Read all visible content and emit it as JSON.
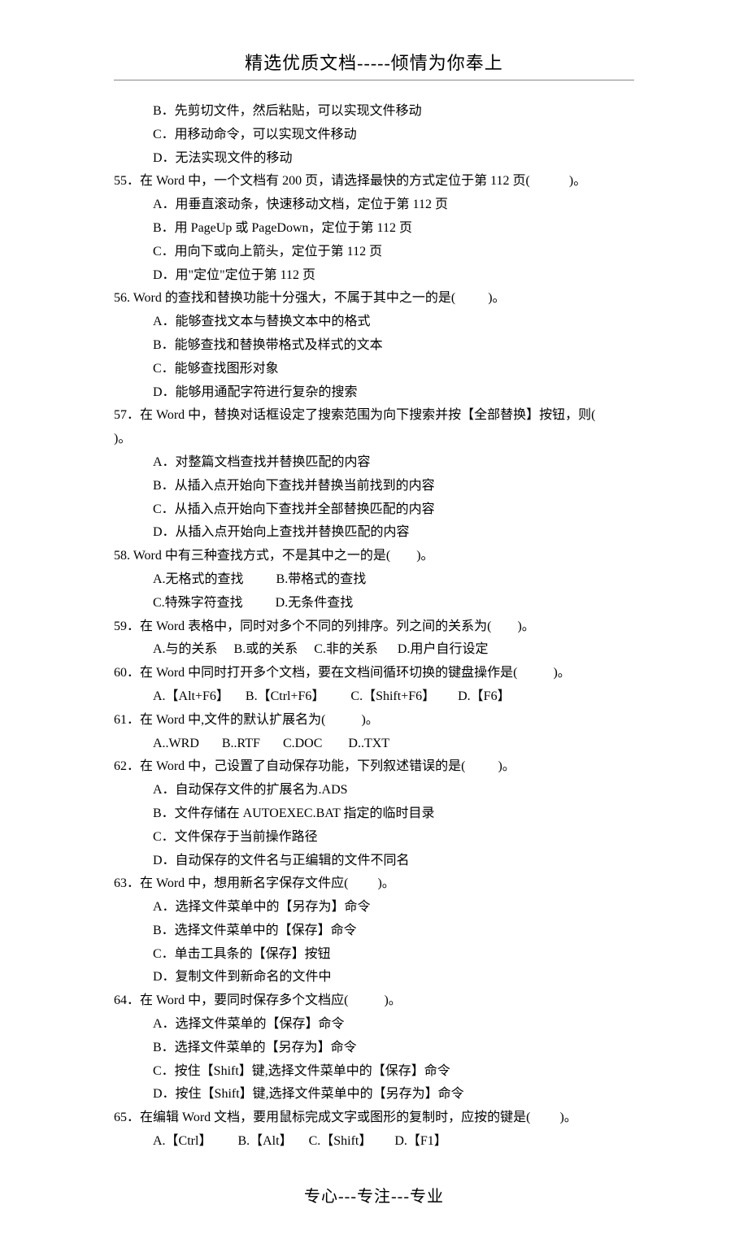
{
  "header": "精选优质文档-----倾情为你奉上",
  "footer": "专心---专注---专业",
  "lines": [
    {
      "cls": "indent-option",
      "text": "B．先剪切文件，然后粘贴，可以实现文件移动"
    },
    {
      "cls": "indent-option",
      "text": "C．用移动命令，可以实现文件移动"
    },
    {
      "cls": "indent-option",
      "text": "D．无法实现文件的移动"
    },
    {
      "cls": "indent-q",
      "text": "55．在 Word 中，一个文档有 200 页，请选择最快的方式定位于第 112 页(            )。"
    },
    {
      "cls": "indent-option",
      "text": "A．用垂直滚动条，快速移动文档，定位于第 112 页"
    },
    {
      "cls": "indent-option",
      "text": "B．用 PageUp 或 PageDown，定位于第 112 页"
    },
    {
      "cls": "indent-option",
      "text": "C．用向下或向上箭头，定位于第 112 页"
    },
    {
      "cls": "indent-option",
      "text": "D．用\"定位\"定位于第 112 页"
    },
    {
      "cls": "indent-q",
      "text": "56. Word 的查找和替换功能十分强大，不属于其中之一的是(          )。"
    },
    {
      "cls": "indent-option",
      "text": "A．能够查找文本与替换文本中的格式"
    },
    {
      "cls": "indent-option",
      "text": "B．能够查找和替换带格式及样式的文本"
    },
    {
      "cls": "indent-option",
      "text": "C．能够查找图形对象"
    },
    {
      "cls": "indent-option",
      "text": "D．能够用通配字符进行复杂的搜索"
    },
    {
      "cls": "indent-q",
      "text": "57．在 Word 中，替换对话框设定了搜索范围为向下搜索并按【全部替换】按钮，则(       )。"
    },
    {
      "cls": "indent-option",
      "text": "A．对整篇文档查找并替换匹配的内容"
    },
    {
      "cls": "indent-option",
      "text": "B．从插入点开始向下查找并替换当前找到的内容"
    },
    {
      "cls": "indent-option",
      "text": "C．从插入点开始向下查找并全部替换匹配的内容"
    },
    {
      "cls": "indent-option",
      "text": "D．从插入点开始向上查找并替换匹配的内容"
    },
    {
      "cls": "indent-q",
      "text": "58. Word 中有三种查找方式，不是其中之一的是(        )。"
    },
    {
      "cls": "indent-option",
      "text": "A.无格式的查找          B.带格式的查找"
    },
    {
      "cls": "indent-option",
      "text": "C.特殊字符查找          D.无条件查找"
    },
    {
      "cls": "indent-q",
      "text": "59．在 Word 表格中，同时对多个不同的列排序。列之间的关系为(        )。"
    },
    {
      "cls": "indent-option",
      "text": "A.与的关系     B.或的关系     C.非的关系      D.用户自行设定"
    },
    {
      "cls": "indent-q",
      "text": "60．在 Word 中同时打开多个文档，要在文档间循环切换的键盘操作是(           )。"
    },
    {
      "cls": "indent-option",
      "text": "A.【Alt+F6】     B.【Ctrl+F6】        C.【Shift+F6】       D.【F6】"
    },
    {
      "cls": "indent-q",
      "text": "61．在 Word 中,文件的默认扩展名为(           )。"
    },
    {
      "cls": "indent-option",
      "text": "A..WRD       B..RTF       C.DOC        D..TXT"
    },
    {
      "cls": "indent-q",
      "text": "62．在 Word 中，己设置了自动保存功能，下列叙述错误的是(          )。"
    },
    {
      "cls": "indent-option",
      "text": "A．自动保存文件的扩展名为.ADS"
    },
    {
      "cls": "indent-option",
      "text": "B．文件存储在 AUTOEXEC.BAT 指定的临时目录"
    },
    {
      "cls": "indent-option",
      "text": "C．文件保存于当前操作路径"
    },
    {
      "cls": "indent-option",
      "text": "D．自动保存的文件名与正编辑的文件不同名"
    },
    {
      "cls": "indent-q",
      "text": "63．在 Word 中，想用新名字保存文件应(         )。"
    },
    {
      "cls": "indent-option",
      "text": "A．选择文件菜单中的【另存为】命令"
    },
    {
      "cls": "indent-option",
      "text": "B．选择文件菜单中的【保存】命令"
    },
    {
      "cls": "indent-option",
      "text": "C．单击工具条的【保存】按钮"
    },
    {
      "cls": "indent-option",
      "text": "D．复制文件到新命名的文件中"
    },
    {
      "cls": "indent-q",
      "text": "64．在 Word 中，要同时保存多个文档应(           )。"
    },
    {
      "cls": "indent-option",
      "text": "A．选择文件菜单的【保存】命令"
    },
    {
      "cls": "indent-option",
      "text": "B．选择文件菜单的【另存为】命令"
    },
    {
      "cls": "indent-option",
      "text": "C．按住【Shift】键,选择文件菜单中的【保存】命令"
    },
    {
      "cls": "indent-option",
      "text": "D．按住【Shift】键,选择文件菜单中的【另存为】命令"
    },
    {
      "cls": "indent-q",
      "text": "65．在编辑 Word 文档，要用鼠标完成文字或图形的复制时，应按的键是(         )。"
    },
    {
      "cls": "indent-option",
      "text": "A.【Ctrl】        B.【Alt】     C.【Shift】       D.【F1】"
    }
  ]
}
